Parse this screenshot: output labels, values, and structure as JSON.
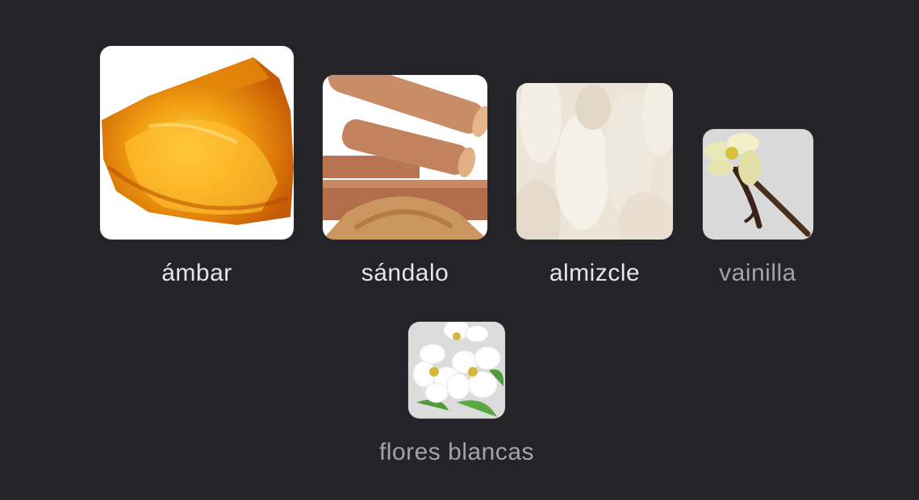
{
  "notes": [
    {
      "label": "ámbar",
      "image": "amber-image",
      "emphasis": "strong"
    },
    {
      "label": "sándalo",
      "image": "sandalwood-image",
      "emphasis": "strong"
    },
    {
      "label": "almizcle",
      "image": "musk-image",
      "emphasis": "strong"
    },
    {
      "label": "vainilla",
      "image": "vanilla-image",
      "emphasis": "muted"
    },
    {
      "label": "flores blancas",
      "image": "white-flowers-image",
      "emphasis": "muted"
    }
  ],
  "colors": {
    "background": "#242328",
    "label_strong": "#e6e6e8",
    "label_muted": "#a4a3aa"
  }
}
